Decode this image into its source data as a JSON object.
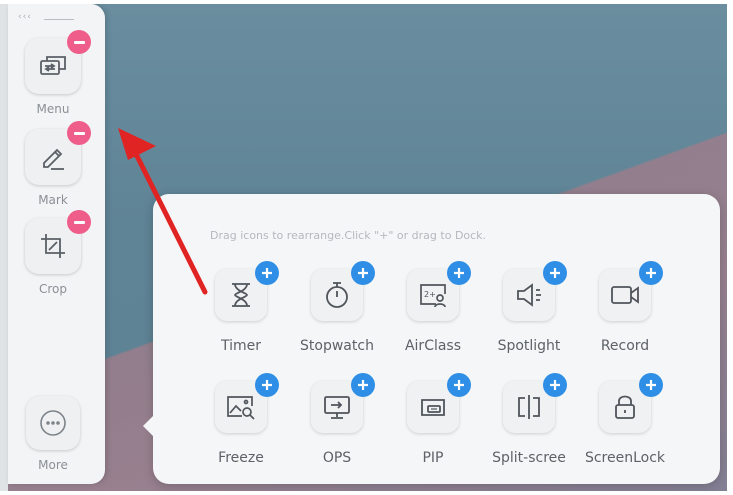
{
  "dock": {
    "items": [
      {
        "label": "Menu",
        "icon": "display-switch-icon"
      },
      {
        "label": "Mark",
        "icon": "pen-icon"
      },
      {
        "label": "Crop",
        "icon": "crop-icon"
      }
    ],
    "more_label": "More"
  },
  "panel": {
    "hint": "Drag icons to rearrange.Click \"+\" or drag to Dock.",
    "tools": [
      {
        "label": "Timer",
        "icon": "hourglass-icon"
      },
      {
        "label": "Stopwatch",
        "icon": "stopwatch-icon"
      },
      {
        "label": "AirClass",
        "icon": "airclass-icon"
      },
      {
        "label": "Spotlight",
        "icon": "spotlight-icon"
      },
      {
        "label": "Record",
        "icon": "video-record-icon"
      },
      {
        "label": "Freeze",
        "icon": "freeze-image-icon"
      },
      {
        "label": "OPS",
        "icon": "monitor-input-icon"
      },
      {
        "label": "PIP",
        "icon": "pip-icon"
      },
      {
        "label": "Split-scree",
        "icon": "split-screen-icon"
      },
      {
        "label": "ScreenLock",
        "icon": "padlock-icon"
      }
    ]
  },
  "colors": {
    "add_badge": "#2f8fe6",
    "remove_badge": "#ef5d8a",
    "annotation_arrow": "#e02424"
  }
}
